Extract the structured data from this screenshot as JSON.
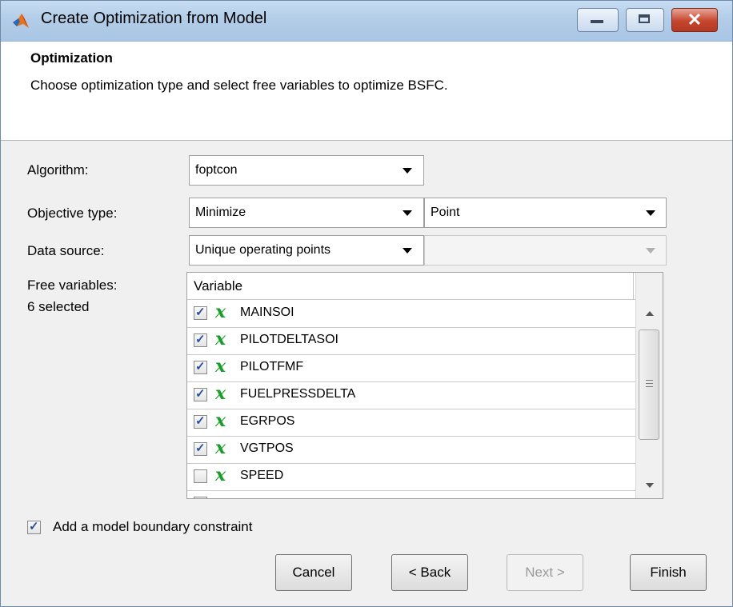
{
  "window": {
    "title": "Create Optimization from Model"
  },
  "header": {
    "title": "Optimization",
    "description": "Choose optimization type and select free variables to optimize BSFC."
  },
  "form": {
    "algorithm_label": "Algorithm:",
    "algorithm_value": "foptcon",
    "objective_label": "Objective type:",
    "objective_value": "Minimize",
    "objective_mode_value": "Point",
    "data_source_label": "Data source:",
    "data_source_value": "Unique operating points",
    "data_source_secondary_value": "",
    "free_variables_label": "Free variables:",
    "free_variables_count": "6 selected"
  },
  "variables_table": {
    "header": "Variable",
    "icon_glyph": "x",
    "rows": [
      {
        "name": "MAINSOI",
        "checked": true
      },
      {
        "name": "PILOTDELTASOI",
        "checked": true
      },
      {
        "name": "PILOTFMF",
        "checked": true
      },
      {
        "name": "FUELPRESSDELTA",
        "checked": true
      },
      {
        "name": "EGRPOS",
        "checked": true
      },
      {
        "name": "VGTPOS",
        "checked": true
      },
      {
        "name": "SPEED",
        "checked": false
      }
    ]
  },
  "boundary": {
    "label": "Add a model boundary constraint",
    "checked": true
  },
  "buttons": {
    "cancel": "Cancel",
    "back": "< Back",
    "next": "Next >",
    "finish": "Finish"
  },
  "colors": {
    "title_gradient_top": "#c6dcf2",
    "close_button": "#c6462f",
    "variable_icon": "#1a9e2a",
    "check_mark": "#2b4f9b"
  },
  "icons": {
    "app": "matlab-icon",
    "minimize": "minimize-icon",
    "maximize": "maximize-icon",
    "close": "close-icon"
  }
}
